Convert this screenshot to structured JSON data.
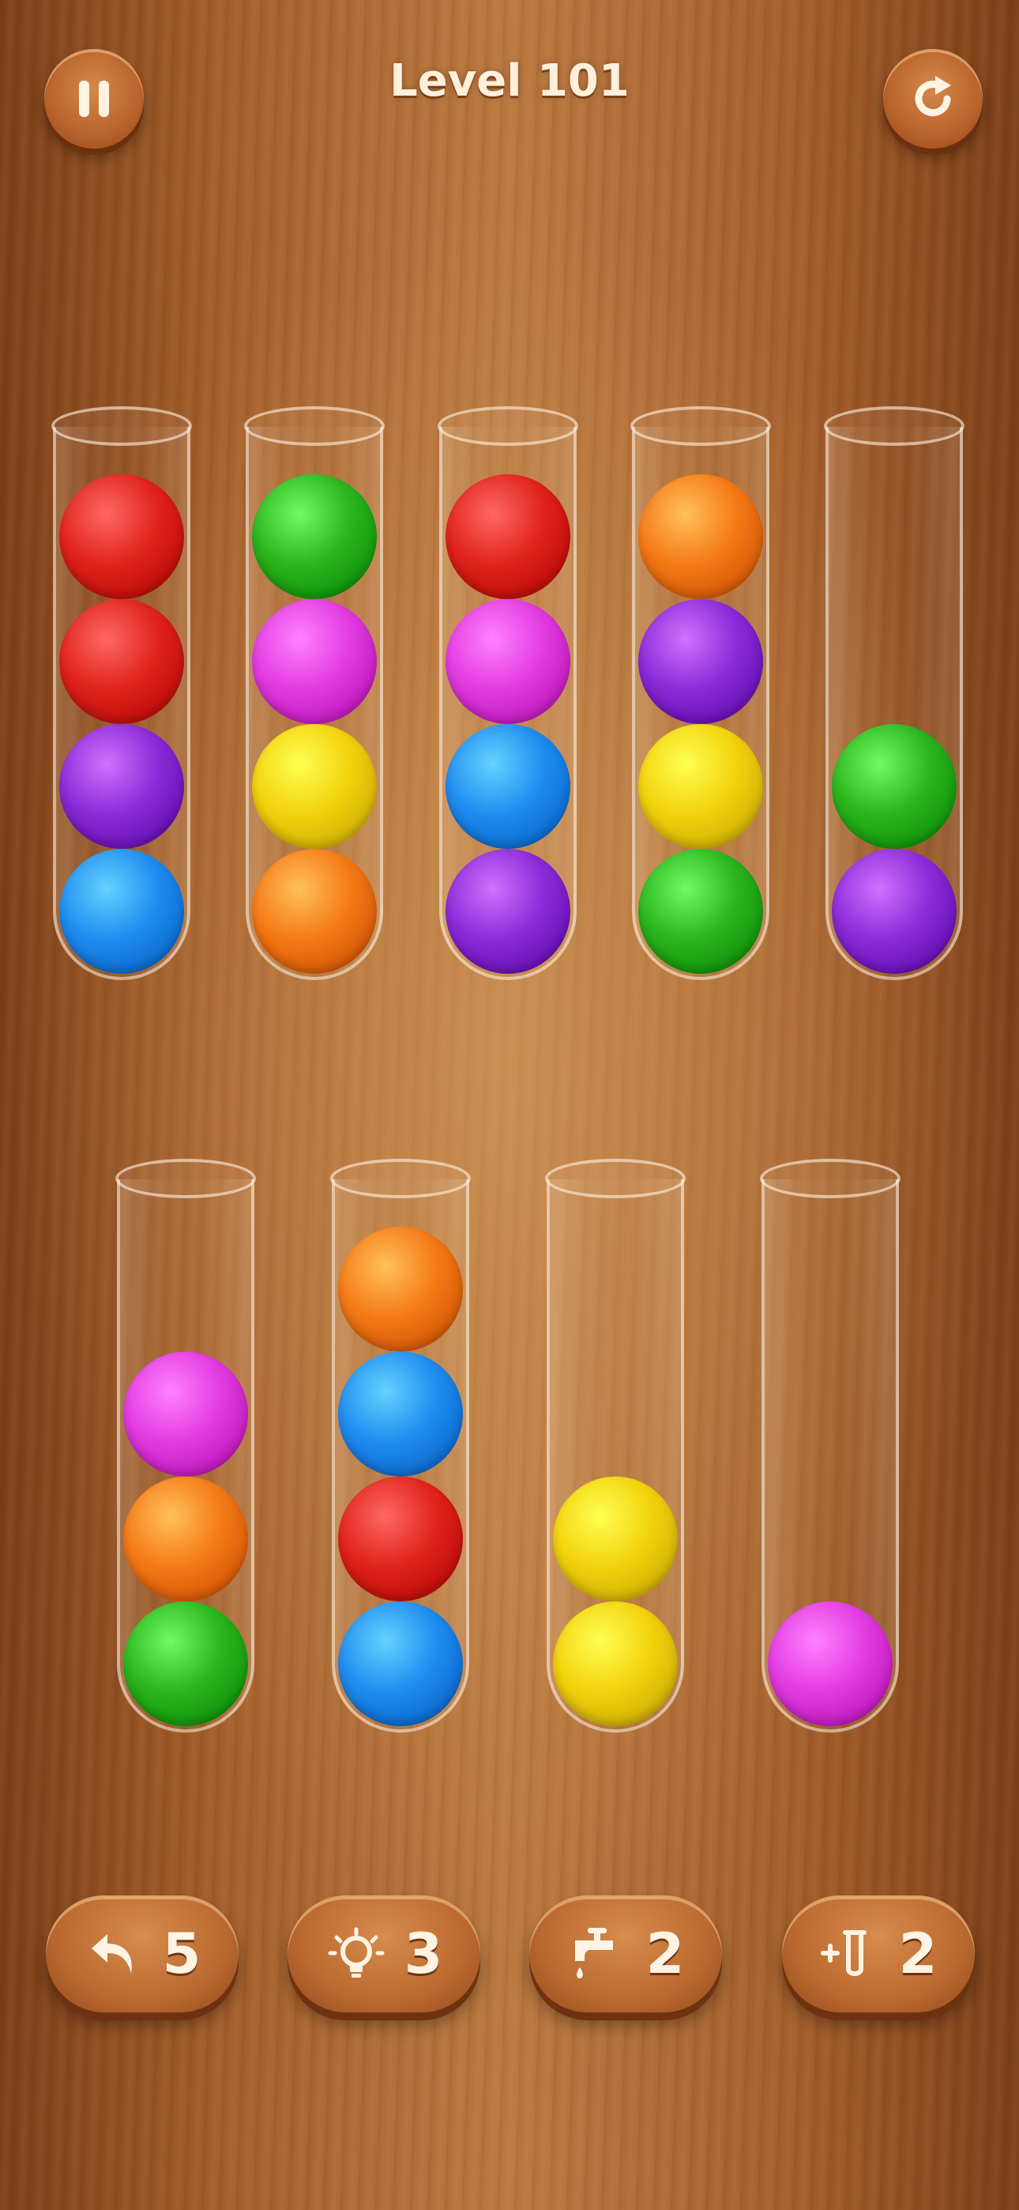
{
  "header": {
    "level_label": "Level 101",
    "pause_icon": "pause-icon",
    "restart_icon": "restart-icon"
  },
  "colors": {
    "red": "#e0221c",
    "green": "#2bb51d",
    "magenta": "#e23be0",
    "yellow": "#f2d20c",
    "orange": "#f57a15",
    "purple": "#8a2bd8",
    "blue": "#1f8cf0"
  },
  "tubes": [
    {
      "id": "tube-1",
      "balls": [
        "blue",
        "purple",
        "red",
        "red"
      ]
    },
    {
      "id": "tube-2",
      "balls": [
        "orange",
        "yellow",
        "magenta",
        "green"
      ]
    },
    {
      "id": "tube-3",
      "balls": [
        "purple",
        "blue",
        "magenta",
        "red"
      ]
    },
    {
      "id": "tube-4",
      "balls": [
        "green",
        "yellow",
        "purple",
        "orange"
      ]
    },
    {
      "id": "tube-5",
      "balls": [
        "purple",
        "green"
      ]
    },
    {
      "id": "tube-6",
      "balls": [
        "green",
        "orange",
        "magenta"
      ]
    },
    {
      "id": "tube-7",
      "balls": [
        "blue",
        "red",
        "blue",
        "orange"
      ]
    },
    {
      "id": "tube-8",
      "balls": [
        "yellow",
        "yellow"
      ]
    },
    {
      "id": "tube-9",
      "balls": [
        "magenta"
      ]
    }
  ],
  "toolbar": {
    "undo": {
      "icon": "undo-icon",
      "count": "5"
    },
    "hint": {
      "icon": "lightbulb-icon",
      "count": "3"
    },
    "tap": {
      "icon": "faucet-icon",
      "count": "2"
    },
    "add_tube": {
      "icon": "add-tube-icon",
      "count": "2"
    }
  }
}
